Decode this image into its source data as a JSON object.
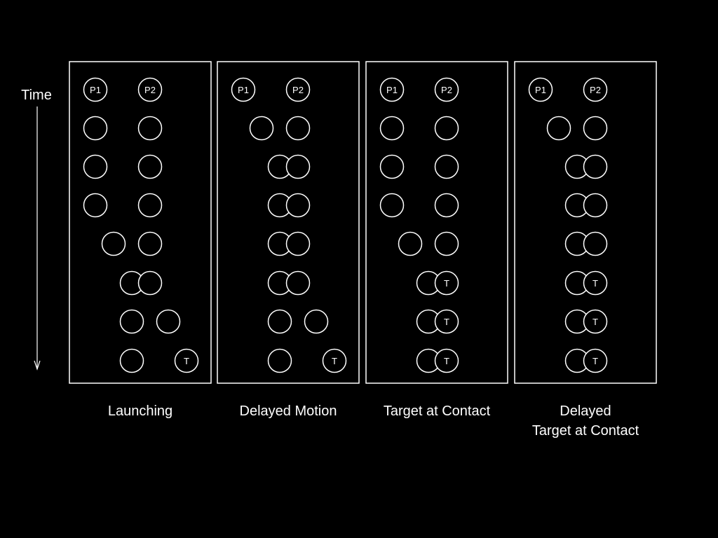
{
  "time_axis": {
    "label": "Time"
  },
  "panels": [
    {
      "title_lines": [
        "Launching"
      ],
      "rows": [
        [
          {
            "slot": 0.0,
            "label": "P1"
          },
          {
            "slot": 3.0,
            "label": "P2"
          }
        ],
        [
          {
            "slot": 0.0,
            "label": ""
          },
          {
            "slot": 3.0,
            "label": ""
          }
        ],
        [
          {
            "slot": 0.0,
            "label": ""
          },
          {
            "slot": 3.0,
            "label": ""
          }
        ],
        [
          {
            "slot": 0.0,
            "label": ""
          },
          {
            "slot": 3.0,
            "label": ""
          }
        ],
        [
          {
            "slot": 1.0,
            "label": ""
          },
          {
            "slot": 3.0,
            "label": ""
          }
        ],
        [
          {
            "slot": 2.0,
            "label": ""
          },
          {
            "slot": 3.0,
            "label": ""
          }
        ],
        [
          {
            "slot": 2.0,
            "label": ""
          },
          {
            "slot": 4.0,
            "label": ""
          }
        ],
        [
          {
            "slot": 2.0,
            "label": ""
          },
          {
            "slot": 5.0,
            "label": "T"
          }
        ]
      ]
    },
    {
      "title_lines": [
        "Delayed Motion"
      ],
      "rows": [
        [
          {
            "slot": 0.0,
            "label": "P1"
          },
          {
            "slot": 3.0,
            "label": "P2"
          }
        ],
        [
          {
            "slot": 1.0,
            "label": ""
          },
          {
            "slot": 3.0,
            "label": ""
          }
        ],
        [
          {
            "slot": 2.0,
            "label": ""
          },
          {
            "slot": 3.0,
            "label": ""
          }
        ],
        [
          {
            "slot": 2.0,
            "label": ""
          },
          {
            "slot": 3.0,
            "label": ""
          }
        ],
        [
          {
            "slot": 2.0,
            "label": ""
          },
          {
            "slot": 3.0,
            "label": ""
          }
        ],
        [
          {
            "slot": 2.0,
            "label": ""
          },
          {
            "slot": 3.0,
            "label": ""
          }
        ],
        [
          {
            "slot": 2.0,
            "label": ""
          },
          {
            "slot": 4.0,
            "label": ""
          }
        ],
        [
          {
            "slot": 2.0,
            "label": ""
          },
          {
            "slot": 5.0,
            "label": "T"
          }
        ]
      ]
    },
    {
      "title_lines": [
        "Target at Contact"
      ],
      "rows": [
        [
          {
            "slot": 0.0,
            "label": "P1"
          },
          {
            "slot": 3.0,
            "label": "P2"
          }
        ],
        [
          {
            "slot": 0.0,
            "label": ""
          },
          {
            "slot": 3.0,
            "label": ""
          }
        ],
        [
          {
            "slot": 0.0,
            "label": ""
          },
          {
            "slot": 3.0,
            "label": ""
          }
        ],
        [
          {
            "slot": 0.0,
            "label": ""
          },
          {
            "slot": 3.0,
            "label": ""
          }
        ],
        [
          {
            "slot": 1.0,
            "label": ""
          },
          {
            "slot": 3.0,
            "label": ""
          }
        ],
        [
          {
            "slot": 2.0,
            "label": ""
          },
          {
            "slot": 3.0,
            "label": "T"
          }
        ],
        [
          {
            "slot": 2.0,
            "label": ""
          },
          {
            "slot": 3.0,
            "label": "T"
          }
        ],
        [
          {
            "slot": 2.0,
            "label": ""
          },
          {
            "slot": 3.0,
            "label": "T"
          }
        ]
      ]
    },
    {
      "title_lines": [
        "Delayed",
        "Target at Contact"
      ],
      "rows": [
        [
          {
            "slot": 0.0,
            "label": "P1"
          },
          {
            "slot": 3.0,
            "label": "P2"
          }
        ],
        [
          {
            "slot": 1.0,
            "label": ""
          },
          {
            "slot": 3.0,
            "label": ""
          }
        ],
        [
          {
            "slot": 2.0,
            "label": ""
          },
          {
            "slot": 3.0,
            "label": ""
          }
        ],
        [
          {
            "slot": 2.0,
            "label": ""
          },
          {
            "slot": 3.0,
            "label": ""
          }
        ],
        [
          {
            "slot": 2.0,
            "label": ""
          },
          {
            "slot": 3.0,
            "label": ""
          }
        ],
        [
          {
            "slot": 2.0,
            "label": ""
          },
          {
            "slot": 3.0,
            "label": "T"
          }
        ],
        [
          {
            "slot": 2.0,
            "label": ""
          },
          {
            "slot": 3.0,
            "label": "T"
          }
        ],
        [
          {
            "slot": 2.0,
            "label": ""
          },
          {
            "slot": 3.0,
            "label": "T"
          }
        ]
      ]
    }
  ]
}
